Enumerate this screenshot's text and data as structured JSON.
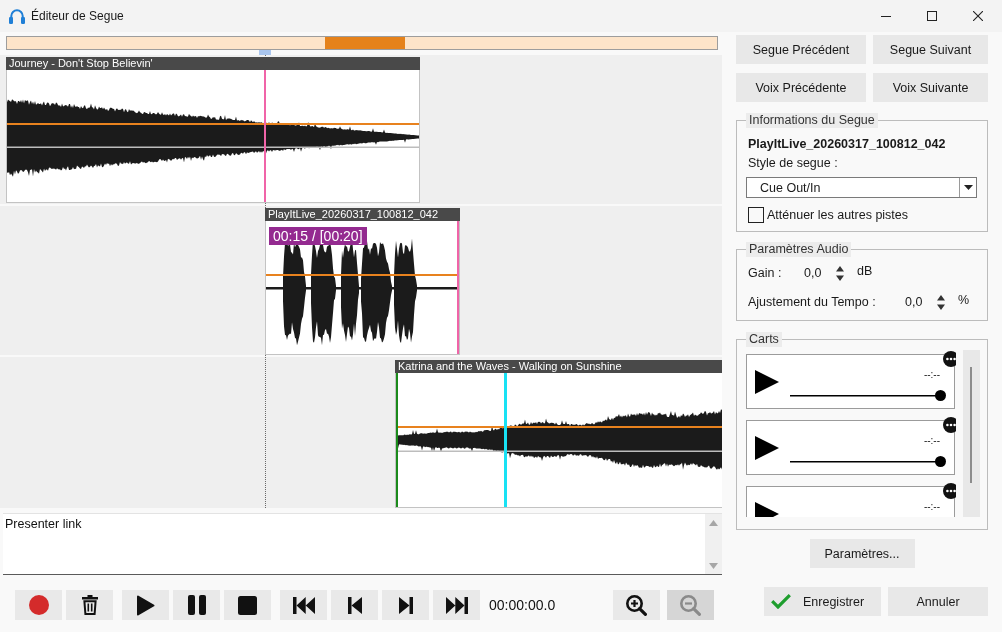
{
  "window": {
    "title": "Éditeur de Segue"
  },
  "timeline": {
    "clips": [
      {
        "title": "Journey - Don't Stop Believin'"
      },
      {
        "title": "PlayItLive_20260317_100812_042",
        "time_badge": "00:15 / [00:20]"
      },
      {
        "title": "Katrina and the Waves - Walking on Sunshine"
      }
    ]
  },
  "notes": {
    "value": "Presenter link"
  },
  "transport": {
    "groups": [
      [
        {
          "kind": "record"
        },
        {
          "kind": "delete"
        }
      ],
      [
        {
          "kind": "play"
        },
        {
          "kind": "pause"
        },
        {
          "kind": "stop"
        }
      ],
      [
        {
          "kind": "skip_start"
        },
        {
          "kind": "previous"
        },
        {
          "kind": "next"
        },
        {
          "kind": "skip_end"
        }
      ]
    ],
    "time": "00:00:00.0",
    "zoom": [
      {
        "kind": "zoom_in",
        "disabled": false
      },
      {
        "kind": "zoom_out",
        "disabled": true
      }
    ]
  },
  "navigation": {
    "buttons": [
      "Segue Précédent",
      "Segue Suivant",
      "Voix Précédente",
      "Voix Suivante"
    ]
  },
  "segue_info": {
    "title": "Informations du Segue",
    "name": "PlayItLive_20260317_100812_042",
    "style_label": "Style de segue :",
    "style_value": "Cue Out/In",
    "attenuate": {
      "label": "Atténuer les autres pistes",
      "checked": false
    }
  },
  "audio": {
    "title": "Paramètres Audio",
    "rows": [
      {
        "label": "Gain :",
        "value": "0,0",
        "unit": "dB"
      },
      {
        "label": "Ajustement du Tempo :",
        "value": "0,0",
        "unit": "%"
      }
    ]
  },
  "carts": {
    "title": "Carts",
    "items": [
      {
        "time": "--:--",
        "level": 1
      },
      {
        "time": "--:--",
        "level": 1
      },
      {
        "time": "--:--"
      }
    ]
  },
  "settings_button": "Paramètres...",
  "footer": {
    "save": "Enregistrer",
    "cancel": "Annuler"
  }
}
